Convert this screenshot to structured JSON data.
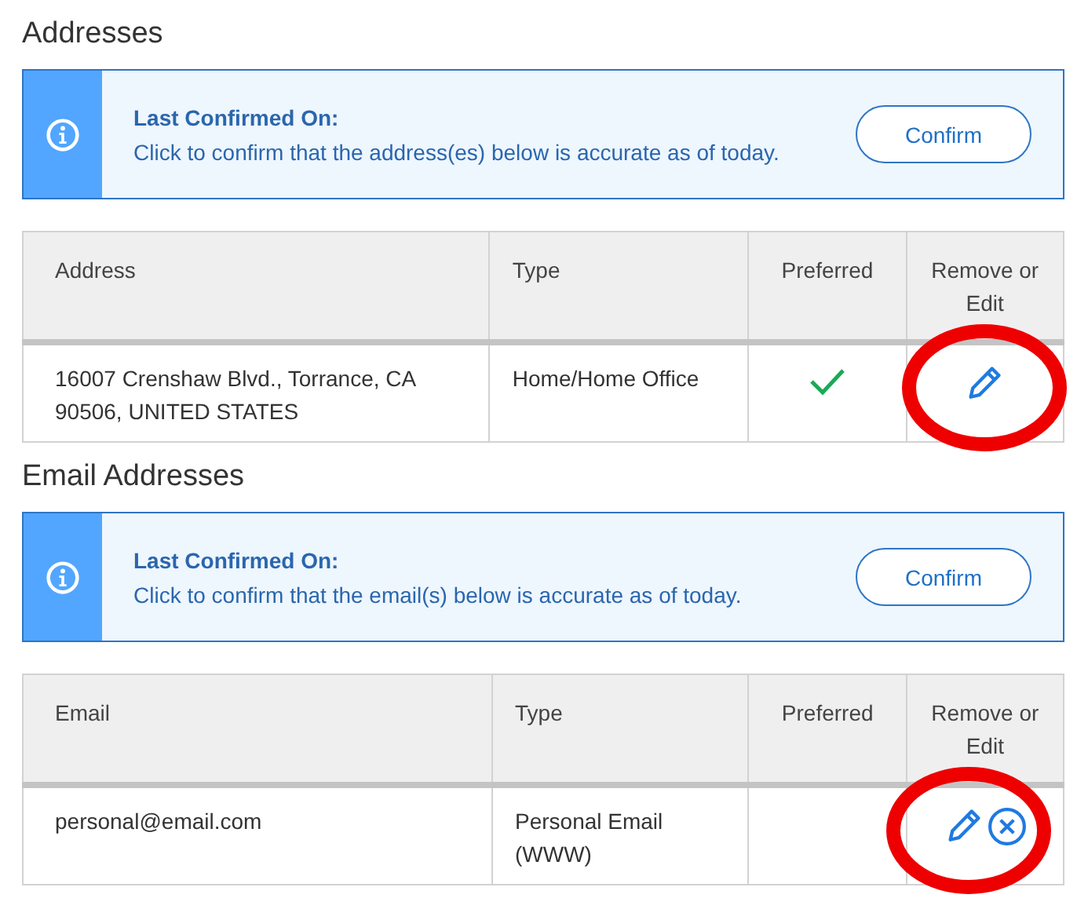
{
  "sections": [
    {
      "title": "Addresses",
      "banner": {
        "heading": "Last Confirmed On:",
        "message": "Click to confirm that the address(es) below is accurate as of today.",
        "button": "Confirm"
      },
      "table": {
        "columns": [
          "Address",
          "Type",
          "Preferred",
          "Remove or Edit"
        ],
        "rows": [
          {
            "cells": [
              "16007 Crenshaw Blvd., Torrance, CA 90506, UNITED STATES",
              "Home/Home Office"
            ],
            "preferred": true,
            "actions": [
              {
                "kind": "edit"
              }
            ],
            "highlighted": true
          }
        ]
      }
    },
    {
      "title": "Email Addresses",
      "banner": {
        "heading": "Last Confirmed On:",
        "message": "Click to confirm that the email(s) below is accurate as of today.",
        "button": "Confirm"
      },
      "table": {
        "columns": [
          "Email",
          "Type",
          "Preferred",
          "Remove or Edit"
        ],
        "rows": [
          {
            "cells": [
              "personal@email.com",
              "Personal Email (WWW)"
            ],
            "preferred": false,
            "actions": [
              {
                "kind": "edit"
              },
              {
                "kind": "remove"
              }
            ],
            "highlighted": true
          }
        ]
      }
    }
  ]
}
